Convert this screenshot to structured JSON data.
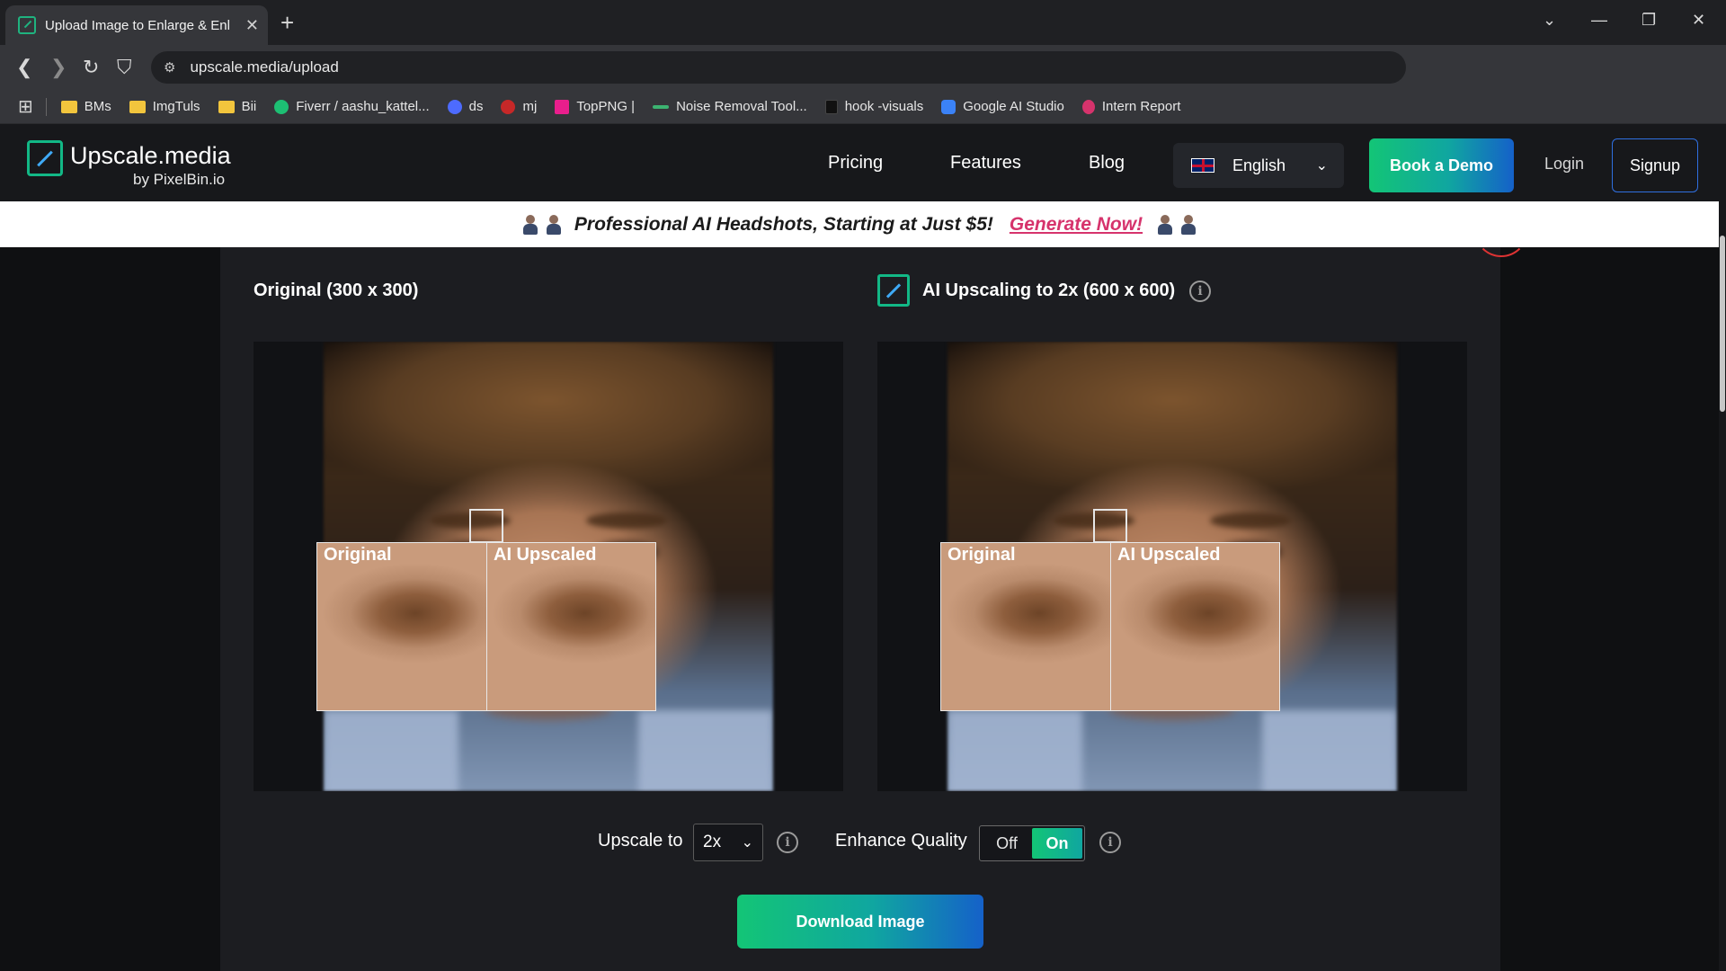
{
  "browser": {
    "tab_title": "Upload Image to Enlarge & Enl",
    "new_tab": "+",
    "url": "upscale.media/upload",
    "bookmarks": [
      {
        "label": "BMs",
        "icon": "folder-icon"
      },
      {
        "label": "ImgTuls",
        "icon": "folder-icon"
      },
      {
        "label": "Bii",
        "icon": "folder-icon"
      },
      {
        "label": "Fiverr / aashu_kattel...",
        "icon": "fiverr-icon"
      },
      {
        "label": "ds",
        "icon": "deepseek-icon"
      },
      {
        "label": "mj",
        "icon": "midjourney-icon"
      },
      {
        "label": "TopPNG |",
        "icon": "toppng-icon"
      },
      {
        "label": "Noise Removal Tool...",
        "icon": "noise-icon"
      },
      {
        "label": "hook -visuals",
        "icon": "tiktok-icon"
      },
      {
        "label": "Google AI Studio",
        "icon": "google-ai-studio-icon"
      },
      {
        "label": "Intern Report",
        "icon": "report-icon"
      }
    ]
  },
  "site": {
    "logo_name": "Upscale.media",
    "logo_sub": "by PixelBin.io",
    "nav": [
      "Pricing",
      "Features",
      "Blog"
    ],
    "language": "English",
    "book_demo": "Book a Demo",
    "login": "Login",
    "signup": "Signup"
  },
  "promo": {
    "text": "Professional AI Headshots, Starting at Just $5!",
    "link": "Generate Now!"
  },
  "compare": {
    "original_title": "Original (300 x 300)",
    "upscaled_title": "AI Upscaling to 2x (600 x 600)",
    "zoom_original": "Original",
    "zoom_upscaled": "AI Upscaled"
  },
  "controls": {
    "upscale_label": "Upscale to",
    "upscale_value": "2x",
    "enhance_label": "Enhance Quality",
    "toggle_off": "Off",
    "toggle_on": "On",
    "enhance_enabled": true,
    "download": "Download Image"
  },
  "colors": {
    "accent_green": "#13c576",
    "accent_blue": "#1561c9",
    "promo_link": "#d6336c"
  }
}
